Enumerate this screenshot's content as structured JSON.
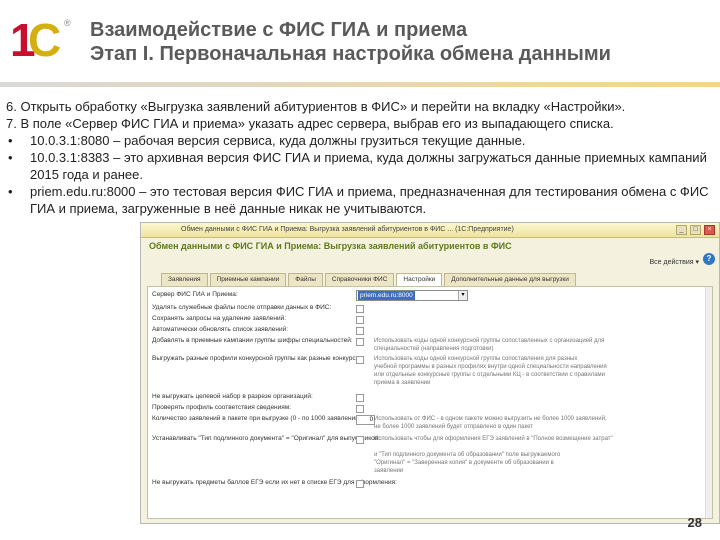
{
  "header": {
    "title_line1": "Взаимодействие с ФИС ГИА и приема",
    "title_line2": "Этап I. Первоначальная настройка обмена данными",
    "logo_text": "1С",
    "logo_reg": "®"
  },
  "body": {
    "p6": "6. Открыть обработку «Выгрузка заявлений абитуриентов в ФИС» и перейти на вкладку «Настройки».",
    "p7": "7. В поле «Сервер ФИС ГИА и приема» указать адрес сервера, выбрав его из выпадающего списка.",
    "bullets": [
      "10.0.3.1:8080 – рабочая версия сервиса, куда должны грузиться текущие данные.",
      "10.0.3.1:8383 – это архивная версия ФИС ГИА и приема, куда должны загружаться данные приемных кампаний 2015 года и ранее.",
      "priem.edu.ru:8000 – это тестовая версия ФИС ГИА и приема, предназначенная для тестирования обмена с ФИС ГИА и приема, загруженные в неё данные никак не учитываются."
    ],
    "bullet_symbol": "•"
  },
  "window": {
    "titlebar": "Обмен данными с ФИС ГИА и Приема: Выгрузка заявлений абитуриентов в ФИС ... (1С:Предприятие)",
    "form_title": "Обмен данными с ФИС ГИА и Приема: Выгрузка заявлений абитуриентов в ФИС",
    "all_actions": "Все действия ▾",
    "help": "?",
    "tabs": [
      "Заявления",
      "Приемные кампании",
      "Файлы",
      "Справочники ФИС",
      "Настройки",
      "Дополнительные данные для выгрузки"
    ],
    "active_tab": "Настройки",
    "server_label": "Сервер ФИС ГИА и Приема:",
    "server_value": "priem.edu.ru:8000",
    "rows": [
      "Удалять служебные файлы после отправки данных в ФИС:",
      "Сохранять запросы на удаление заявлений:",
      "Автоматически обновлять список заявлений:",
      "Добавлять в приемные кампании группы шифры специальностей:",
      "Выгружать разные профили конкурсной группы как разные конкурсы:",
      "Не выгружать целевой набор в разрезе организаций:",
      "Проверять профиль соответствия сведениям:",
      "Количество заявлений в пакете при выгрузке (0 - по 1000 заявлений):",
      "Устанавливать \"Тип подлинного документа\" = \"Оригинал\" для выпускников:",
      "Не выгружать предметы баллов ЕГЭ если их нет в списке ЕГЭ для оформления:"
    ],
    "notes": [
      "Использовать коды одной конкурсной группы сопоставленных с организацией для",
      "специальностей (направления подготовки)",
      "Использовать коды одной конкурсной группы сопоставления для разных",
      "учебной программы в разных профилях внутри одной специальности направления",
      "или отдельные конкурсные группы с отдельными КЦ - в соответствии с правилами",
      "приема в заявлении",
      "Использовать от ФИС - в одном пакете можно выгрузить не более 1000 заявлений;",
      "не более 1000 заявлений будет отправлено в один пакет",
      "Использовать чтобы для оформления ЕГЭ заявлений в \"Полное возмещение затрат\"",
      "и \"Тип подлинного документа об образовании\" поле выгружаемого",
      "\"Оригинал\" = \"Заверенная копия\" в документе об образовании в",
      "заявлении"
    ],
    "count_value": "0"
  },
  "page_number": "28"
}
